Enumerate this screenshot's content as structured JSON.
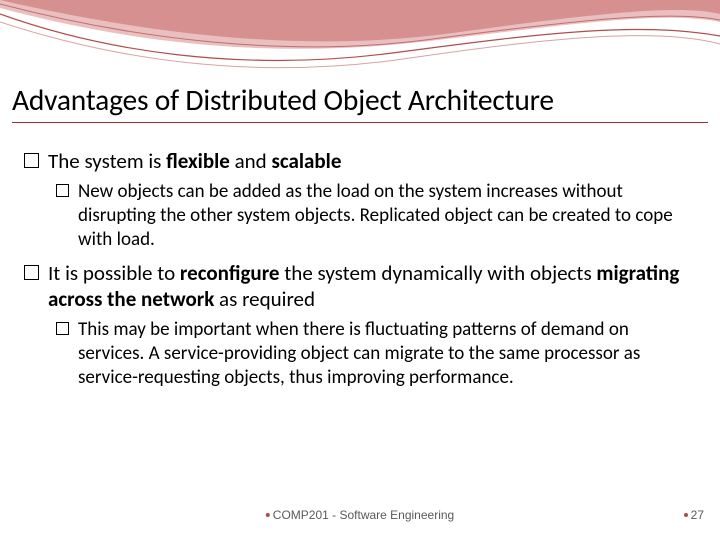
{
  "title": "Advantages of Distributed Object Architecture",
  "points": {
    "p1": {
      "pre": "The system is ",
      "bold1": "flexible",
      "mid": " and ",
      "bold2": "scalable",
      "sub": "New objects can be added as the load on the system increases without disrupting the other system objects. Replicated object can be created to cope with load."
    },
    "p2": {
      "pre": "It is possible to ",
      "bold1": "reconfigure",
      "mid1": " the system dynamically with objects ",
      "bold2": "migrating across the network",
      "post": " as required",
      "sub": "This may be important when there is fluctuating patterns of demand on services. A service-providing object can migrate to the same processor as service-requesting objects, thus improving performance."
    }
  },
  "footer": {
    "course": "COMP201 - Software Engineering",
    "page": "27"
  }
}
